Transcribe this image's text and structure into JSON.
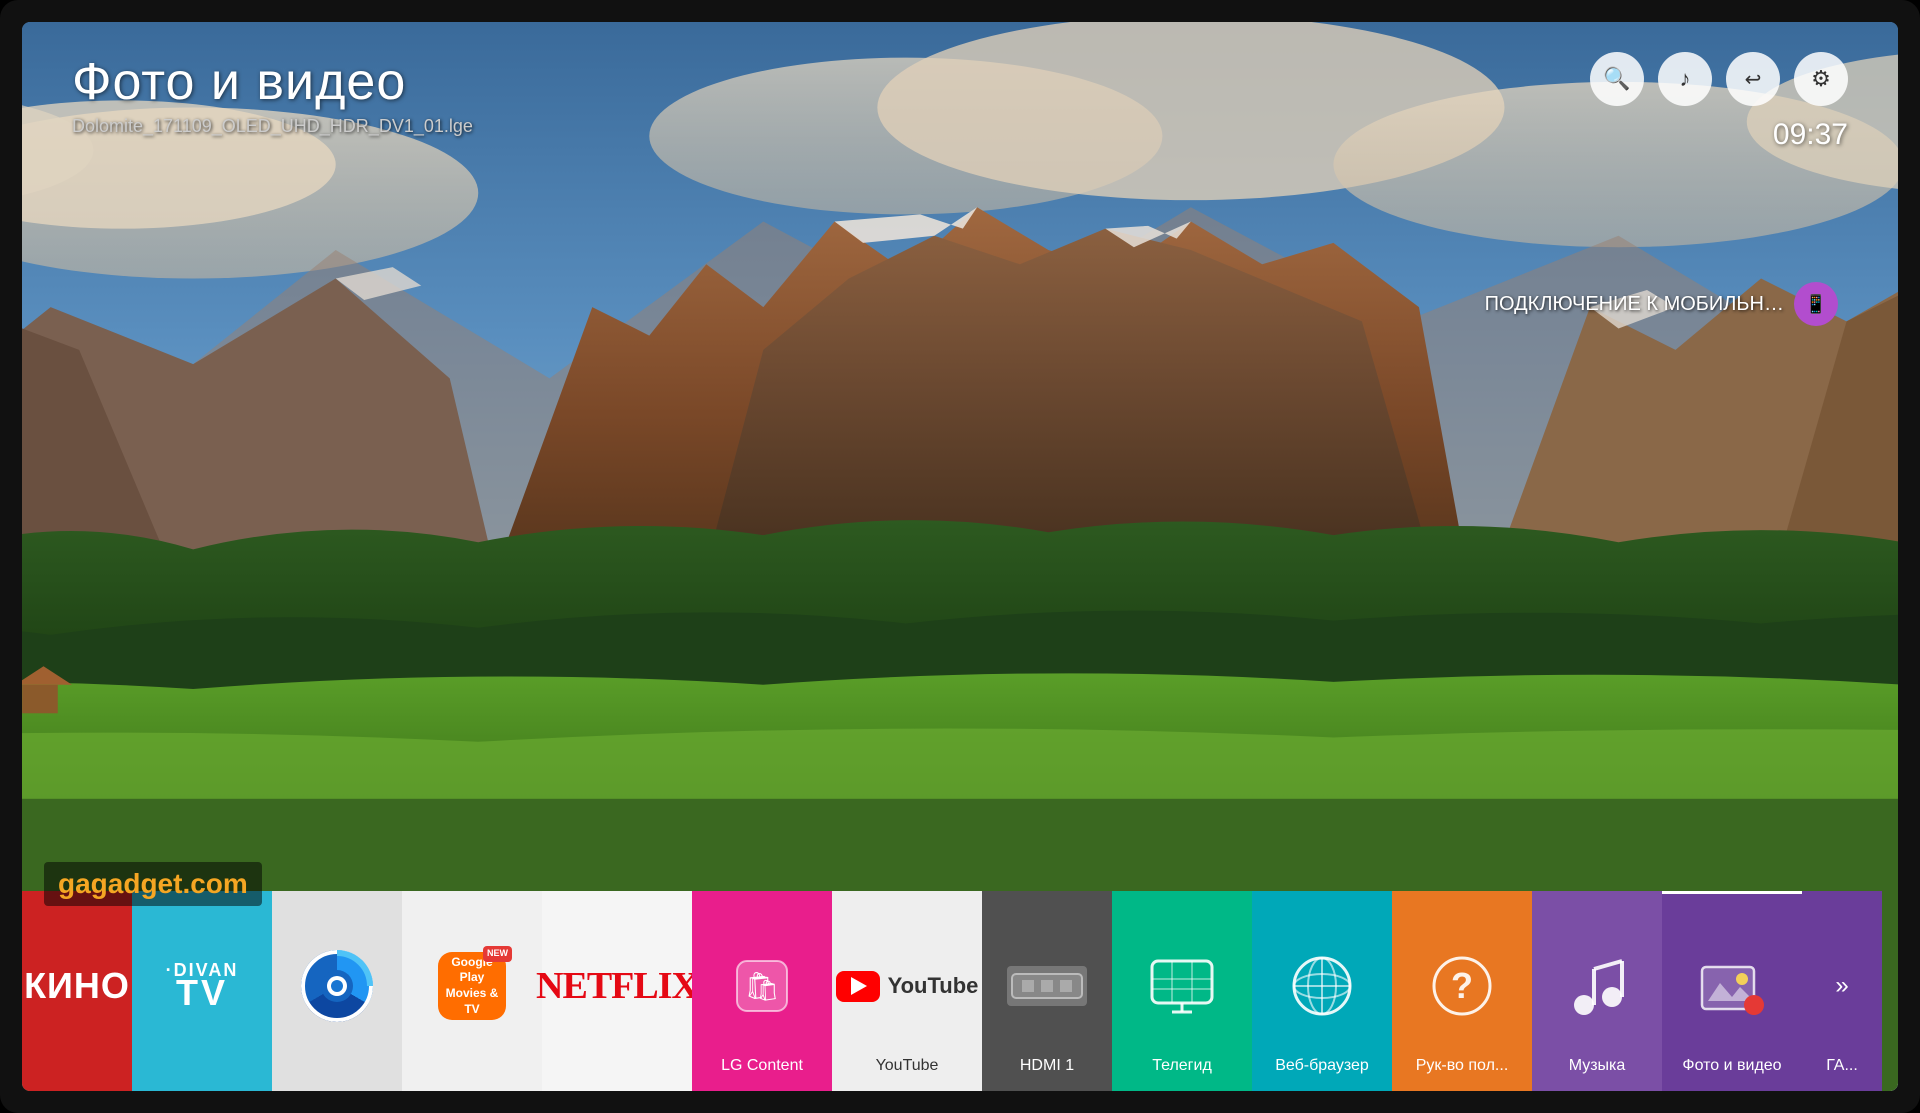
{
  "tv": {
    "screen": {
      "title": "Фото и видео",
      "subtitle": "Dolomite_171109_OLED_UHD_HDR_DV1_01.lge",
      "time": "09:37",
      "mobile_connect_label": "ПОДКЛЮЧЕНИЕ К МОБИЛЬН…",
      "watermark": "gagadget.com"
    },
    "header_icons": {
      "search": "🔍",
      "music": "♪",
      "back": "↩",
      "settings": "⚙"
    },
    "apps": [
      {
        "id": "kino",
        "label": "КИНО",
        "color": "tile-red",
        "logo_type": "text_red",
        "logo_text": "КИНО"
      },
      {
        "id": "divan",
        "label": "",
        "color": "tile-cyan",
        "logo_type": "divan",
        "logo_text": "DIVAN TV"
      },
      {
        "id": "okko",
        "label": "",
        "color": "tile-lightgray",
        "logo_type": "circle",
        "logo_text": ""
      },
      {
        "id": "gplay",
        "label": "",
        "color": "tile-white",
        "logo_type": "gplay",
        "logo_text": "Google Play\nMovies & TV"
      },
      {
        "id": "netflix",
        "label": "",
        "color": "tile-white2",
        "logo_type": "netflix",
        "logo_text": "NETFLIX"
      },
      {
        "id": "lgcontent",
        "label": "LG Content",
        "color": "tile-pink",
        "logo_type": "lgcontent",
        "logo_text": "🛍"
      },
      {
        "id": "youtube",
        "label": "YouTube",
        "color": "tile-white3",
        "logo_type": "youtube",
        "logo_text": "YouTube"
      },
      {
        "id": "hdmi1",
        "label": "HDMI 1",
        "color": "tile-darkgray",
        "logo_type": "hdmi",
        "logo_text": "HDMI"
      },
      {
        "id": "tvguide",
        "label": "Телегид",
        "color": "tile-green",
        "logo_type": "tvguide",
        "logo_text": ""
      },
      {
        "id": "browser",
        "label": "Веб-браузер",
        "color": "tile-teal",
        "logo_type": "browser",
        "logo_text": ""
      },
      {
        "id": "manual",
        "label": "Рук-во пол...",
        "color": "tile-orange",
        "logo_type": "help",
        "logo_text": "?"
      },
      {
        "id": "music",
        "label": "Музыка",
        "color": "tile-purple",
        "logo_type": "music",
        "logo_text": "♪"
      },
      {
        "id": "photovideo",
        "label": "Фото и видео",
        "color": "tile-active-purple",
        "logo_type": "photo",
        "logo_text": "🖼"
      },
      {
        "id": "gallery",
        "label": "ГА...",
        "color": "tile-active-purple",
        "logo_type": "gallery",
        "logo_text": "»"
      }
    ]
  }
}
